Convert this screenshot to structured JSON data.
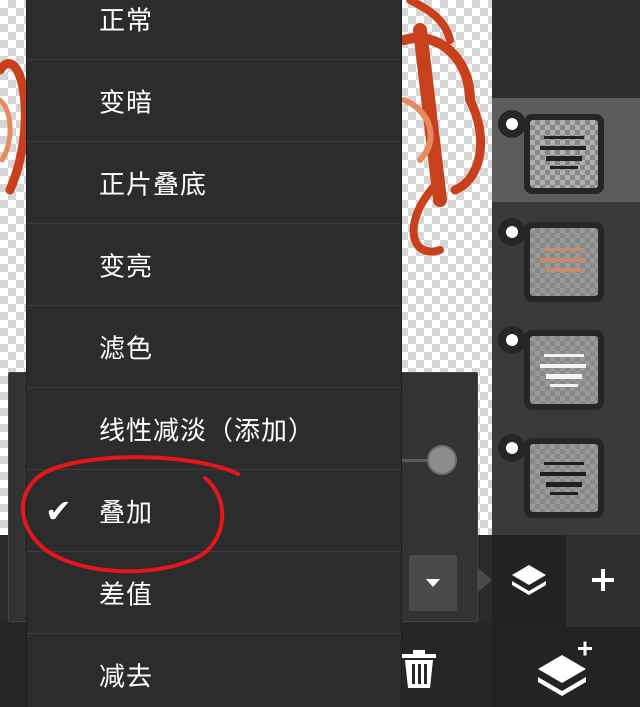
{
  "blend_menu": {
    "items": [
      {
        "label": "正常",
        "selected": false
      },
      {
        "label": "变暗",
        "selected": false
      },
      {
        "label": "正片叠底",
        "selected": false
      },
      {
        "label": "变亮",
        "selected": false
      },
      {
        "label": "滤色",
        "selected": false
      },
      {
        "label": "线性减淡（添加）",
        "selected": false
      },
      {
        "label": "叠加",
        "selected": true
      },
      {
        "label": "差值",
        "selected": false
      },
      {
        "label": "减去",
        "selected": false
      }
    ],
    "checkmark": "✔"
  },
  "layers": {
    "count": 4,
    "selected_index": 0
  },
  "icons": {
    "layers": "layers-stack-icon",
    "add": "plus-icon",
    "add_layer": "add-layer-icon",
    "delete": "trash-icon",
    "dropdown": "caret-down-icon"
  },
  "colors": {
    "annotation": "#e8161b",
    "art_red": "#c8401c"
  }
}
